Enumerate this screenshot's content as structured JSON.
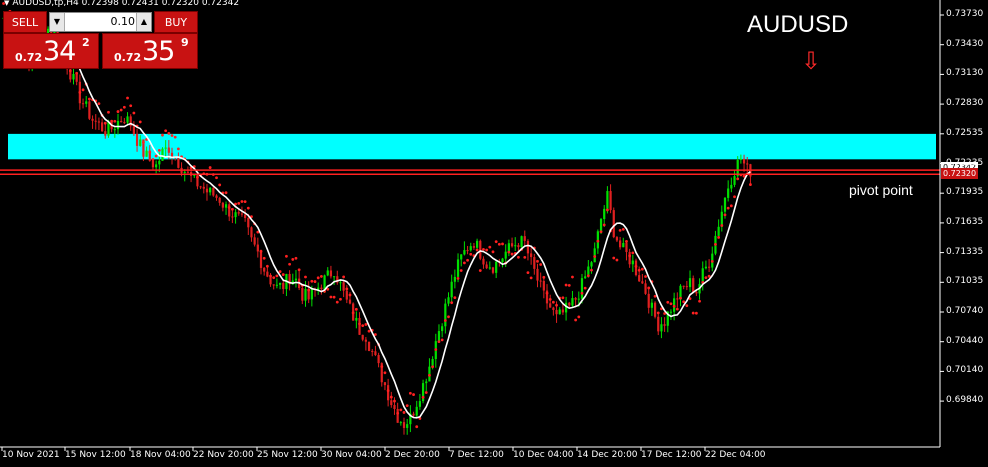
{
  "header": {
    "title": "AUDUSD,tp,H4  0.72398 0.72431 0.72320 0.72342"
  },
  "trade_panel": {
    "sell_label": "SELL",
    "buy_label": "BUY",
    "lot_value": "0.10",
    "sell_price": {
      "small": "0.72",
      "big": "34",
      "sup": "2"
    },
    "buy_price": {
      "small": "0.72",
      "big": "35",
      "sup": "9"
    }
  },
  "annotations": {
    "symbol": "AUDUSD",
    "arrow": "⇩",
    "pivot_label": "pivot point"
  },
  "price_axis": [
    "0.73730",
    "0.73430",
    "0.73130",
    "0.72830",
    "0.72535",
    "0.72235",
    "0.71935",
    "0.71635",
    "0.71335",
    "0.71035",
    "0.70740",
    "0.70440",
    "0.70140",
    "0.69840"
  ],
  "current_prices": {
    "ask": "0.72342",
    "bid": "0.72320"
  },
  "time_axis": [
    "10 Nov 2021",
    "15 Nov 12:00",
    "18 Nov 04:00",
    "22 Nov 20:00",
    "25 Nov 12:00",
    "30 Nov 04:00",
    "2 Dec 20:00",
    "7 Dec 12:00",
    "10 Dec 04:00",
    "14 Dec 20:00",
    "17 Dec 12:00",
    "22 Dec 04:00"
  ],
  "colors": {
    "background": "#000000",
    "bull": "#00e000",
    "bear": "#e02020",
    "ma": "#ffffff",
    "sar": "#ff2020",
    "zone": "#00ffff",
    "pivot_line": "#ff2020",
    "panel": "#c81212"
  },
  "chart_data": {
    "type": "candlestick",
    "symbol": "AUDUSD",
    "timeframe": "H4",
    "ylim": [
      0.6984,
      0.7388
    ],
    "resistance_zone": [
      0.7244,
      0.7267
    ],
    "pivot_lines": [
      0.72342,
      0.72305
    ],
    "close_path": [
      0.7372,
      0.7365,
      0.7355,
      0.734,
      0.733,
      0.7338,
      0.735,
      0.7362,
      0.7358,
      0.7345,
      0.733,
      0.7315,
      0.73,
      0.729,
      0.728,
      0.7275,
      0.727,
      0.7272,
      0.7278,
      0.7282,
      0.7276,
      0.7262,
      0.725,
      0.7243,
      0.7238,
      0.725,
      0.7255,
      0.7246,
      0.7238,
      0.723,
      0.7224,
      0.722,
      0.7215,
      0.7212,
      0.7208,
      0.72,
      0.7195,
      0.719,
      0.7185,
      0.717,
      0.716,
      0.7145,
      0.7135,
      0.7128,
      0.713,
      0.7138,
      0.7135,
      0.7122,
      0.7118,
      0.7125,
      0.7132,
      0.7138,
      0.7145,
      0.713,
      0.7115,
      0.7102,
      0.709,
      0.7085,
      0.707,
      0.7055,
      0.704,
      0.7025,
      0.7012,
      0.7005,
      0.701,
      0.7025,
      0.704,
      0.7058,
      0.708,
      0.71,
      0.712,
      0.714,
      0.7155,
      0.7165,
      0.717,
      0.716,
      0.715,
      0.7148,
      0.7152,
      0.716,
      0.7165,
      0.717,
      0.7168,
      0.715,
      0.7135,
      0.712,
      0.711,
      0.71,
      0.7105,
      0.711,
      0.7118,
      0.713,
      0.7145,
      0.716,
      0.719,
      0.721,
      0.718,
      0.7165,
      0.7158,
      0.715,
      0.7138,
      0.7125,
      0.7108,
      0.7095,
      0.7098,
      0.711,
      0.712,
      0.7128,
      0.7132,
      0.7125,
      0.714,
      0.7152,
      0.7175,
      0.7198,
      0.722,
      0.7235,
      0.7245,
      0.7234
    ]
  }
}
